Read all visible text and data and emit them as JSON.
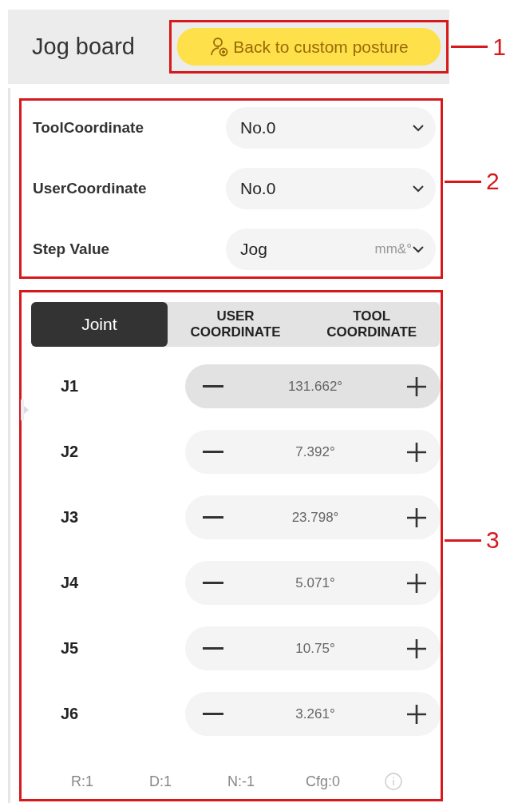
{
  "header": {
    "title": "Jog board",
    "button": "Back to custom posture",
    "callout": "1"
  },
  "settings": {
    "callout": "2",
    "rows": [
      {
        "label": "ToolCoordinate",
        "value": "No.0"
      },
      {
        "label": "UserCoordinate",
        "value": "No.0"
      },
      {
        "label": "Step Value",
        "value": "Jog",
        "unit": "mm&°"
      }
    ]
  },
  "jog": {
    "callout": "3",
    "tabs": [
      {
        "label": "Joint",
        "selected": true
      },
      {
        "label": "USER\nCOORDINATE",
        "selected": false
      },
      {
        "label": "TOOL\nCOORDINATE",
        "selected": false
      }
    ],
    "joints": [
      {
        "name": "J1",
        "value": "131.662°",
        "pressed": true
      },
      {
        "name": "J2",
        "value": "7.392°",
        "pressed": false
      },
      {
        "name": "J3",
        "value": "23.798°",
        "pressed": false
      },
      {
        "name": "J4",
        "value": "5.071°",
        "pressed": false
      },
      {
        "name": "J5",
        "value": "10.75°",
        "pressed": false
      },
      {
        "name": "J6",
        "value": "3.261°",
        "pressed": false
      }
    ],
    "status": [
      "R:1",
      "D:1",
      "N:-1",
      "Cfg:0"
    ]
  }
}
